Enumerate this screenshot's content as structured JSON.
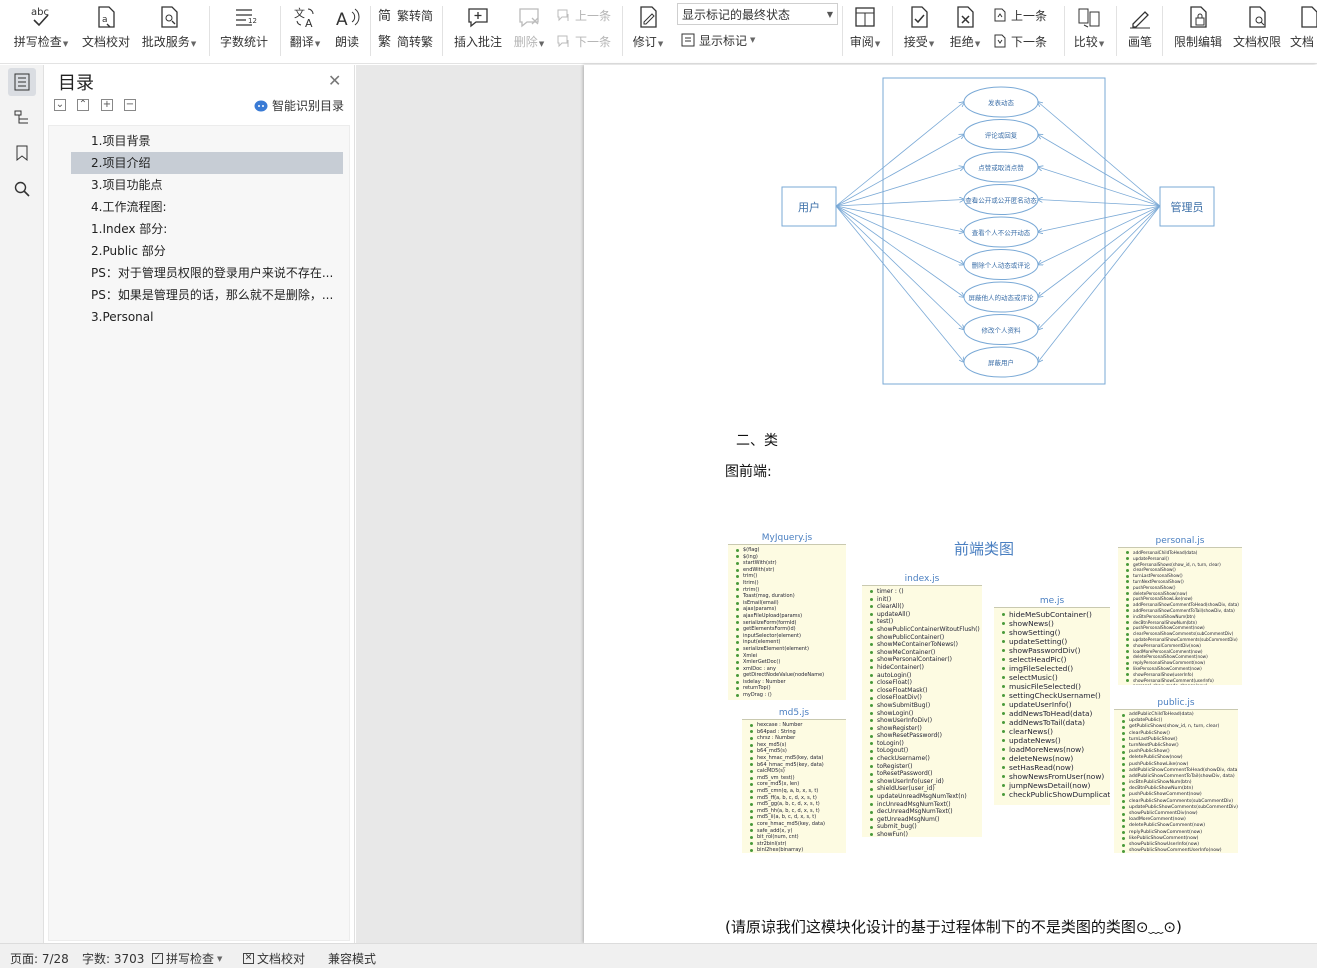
{
  "ribbon": {
    "spellcheck": "拼写检查",
    "doc_proof": "文档校对",
    "review_service": "批改服务",
    "word_count": "字数统计",
    "translate": "翻译",
    "read_aloud": "朗读",
    "trad_to_simp": "繁转简",
    "simp_to_trad": "简转繁",
    "insert_comment": "插入批注",
    "delete_comment": "删除",
    "prev_comment": "上一条",
    "next_comment": "下一条",
    "track_changes": "修订",
    "markup_state": "显示标记的最终状态",
    "show_markup": "显示标记",
    "review": "审阅",
    "accept": "接受",
    "reject": "拒绝",
    "prev_change": "上一条",
    "next_change": "下一条",
    "compare": "比较",
    "pen": "画笔",
    "restrict_edit": "限制编辑",
    "doc_permission": "文档权限",
    "doc_cut": "文档"
  },
  "toc": {
    "title": "目录",
    "smart_label": "智能识别目录",
    "items": [
      {
        "label": "1.项目背景",
        "selected": false
      },
      {
        "label": "2.项目介绍",
        "selected": true
      },
      {
        "label": "3.项目功能点",
        "selected": false
      },
      {
        "label": "4.工作流程图:",
        "selected": false
      },
      {
        "label": "1.Index 部分:",
        "selected": false
      },
      {
        "label": "2.Public 部分",
        "selected": false
      },
      {
        "label": "PS：对于管理员权限的登录用户来说不存在...",
        "selected": false
      },
      {
        "label": "PS：如果是管理员的话，那么就不是删除，...",
        "selected": false
      },
      {
        "label": "3.Personal",
        "selected": false
      }
    ]
  },
  "document": {
    "usecase": {
      "actor_user": "用户",
      "actor_admin": "管理员",
      "cases": [
        "发表动态",
        "评论或回复",
        "点赞或取消点赞",
        "查看公开或公开匿名动态",
        "查看个人不公开动态",
        "删除个人动态或评论",
        "屏蔽他人的动态或评论",
        "修改个人资料",
        "屏蔽用户"
      ]
    },
    "section_heading": "二、类",
    "section_sub": "图前端:",
    "class_diagram": {
      "title": "前端类图",
      "classes": [
        {
          "name": "MyJquery.js",
          "members": [
            "$(flag)",
            "$(ing)",
            "startWith(str)",
            "endWith(str)",
            "trim()",
            "ltrim()",
            "rtrim()",
            "Toast(msg, duration)",
            "isEmail(email)",
            "ajax(params)",
            "ajaxFileUpload(params)",
            "serializeForm(formId)",
            "getElementsForm(id)",
            "inputSelector(element)",
            "input(element)",
            "serializeElement(element)",
            "Xmlei",
            "XmlerGetDoc()",
            "xmlDoc : any",
            "getDirectNodeValue(nodeName)",
            "isdelay : Number",
            "returnTop()",
            "myDrag : ()"
          ]
        },
        {
          "name": "md5.js",
          "members": [
            "hexcase : Number",
            "b64pad : String",
            "chrsz : Number",
            "hex_md5(s)",
            "b64_md5(s)",
            "hex_hmac_md5(key, data)",
            "b64_hmac_md5(key, data)",
            "calcMD5(s)",
            "md5_vm_test()",
            "core_md5(x, len)",
            "md5_cmn(q, a, b, x, s, t)",
            "md5_ff(a, b, c, d, x, s, t)",
            "md5_gg(a, b, c, d, x, s, t)",
            "md5_hh(a, b, c, d, x, s, t)",
            "md5_ii(a, b, c, d, x, s, t)",
            "core_hmac_md5(key, data)",
            "safe_add(x, y)",
            "bit_rol(num, cnt)",
            "str2binl(str)",
            "binl2hex(binarray)",
            "binl2b64(binarray)"
          ]
        },
        {
          "name": "index.js",
          "members": [
            "timer : ()",
            "init()",
            "clearAll()",
            "updateAll()",
            "test()",
            "showPublicContainerWitoutFlush()",
            "showPublicContainer()",
            "showMeContainerToNews()",
            "showMeContainer()",
            "showPersonalContainer()",
            "hideContainer()",
            "autoLogin()",
            "closeFloat()",
            "closeFloatMask()",
            "closeFloatDiv()",
            "showSubmitBug()",
            "showLogin()",
            "showUserInfoDiv()",
            "showRegister()",
            "showResetPassword()",
            "toLogin()",
            "toLogout()",
            "checkUsername()",
            "toRegister()",
            "toResetPassword()",
            "showUserInfo(user_id)",
            "shieldUser(user_id)",
            "updateUnreadMsgNumText(n)",
            "incUnreadMsgNumText()",
            "decUnreadMsgNumText()",
            "getUnreadMsgNum()",
            "submit_bug()",
            "showFun()"
          ]
        },
        {
          "name": "me.js",
          "members": [
            "hideMeSubContainer()",
            "showNews()",
            "showSetting()",
            "updateSetting()",
            "showPasswordDiv()",
            "selectHeadPic()",
            "imgFileSelected()",
            "selectMusic()",
            "musicFileSelected()",
            "settingCheckUsername()",
            "updateUserInfo()",
            "addNewsToHead(data)",
            "addNewsToTail(data)",
            "clearNews()",
            "updateNews()",
            "loadMoreNews(now)",
            "deleteNews(now)",
            "setHasRead(now)",
            "showNewsFromUser(now)",
            "jumpNewsDetail(now)",
            "checkPublicShowDumplicate()"
          ]
        },
        {
          "name": "personal.js",
          "members": [
            "addPersonalChildToHead(data)",
            "updatePersonal()",
            "getPersonalShows(show_id, n, turn, clear)",
            "clearPersonalShow()",
            "turnLastPersonalShow()",
            "turnNextPersonalShow()",
            "pushPersonalShow()",
            "deletePersonalShow(now)",
            "pushPersonalShowLike(now)",
            "addPersonalShowCommentToHead(showDiv, data)",
            "addPersonalShowCommentToTail(showDiv, data)",
            "incBtnPersonalShowNum(btn)",
            "decBtnPersonalShowNum(btn)",
            "pushPersonalShowComment(now)",
            "clearPersonalShowComments(subCommentDiv)",
            "updatePersonalShowComments(subCommentDiv)",
            "showPersonalCommentDiv(now)",
            "loadMorePersonalComment(now)",
            "deletePersonalShowComment(now)",
            "replyPersonalShowComment(now)",
            "likePersonalShowComment(now)",
            "showPersonalShow(userInfo)",
            "showPersonalShowComment(userInfo)",
            "personal_show_mode_change(now)"
          ]
        },
        {
          "name": "public.js",
          "members": [
            "addPublicChildToHead(data)",
            "updatePublic()",
            "getPublicShows(show_id, n, turn, clear)",
            "clearPublicShow()",
            "turnLastPublicShow()",
            "turnNextPublicShow()",
            "pushPublicShow()",
            "deletePublicShow(now)",
            "pushPublicShowLike(now)",
            "addPublicShowCommentToHead(showDiv, data)",
            "addPublicShowCommentToTail(showDiv, data)",
            "incBtnPublicShowNum(btn)",
            "decBtnPublicShowNum(btn)",
            "pushPublicShowComment(now)",
            "clearPublicShowComments(subCommentDiv)",
            "updatePublicShowComments(subCommentDiv)",
            "showPublicCommentDiv(now)",
            "loadMoreComment(now)",
            "deletePublicShowComment(now)",
            "replyPublicShowComment(now)",
            "likePublicShowComment(now)",
            "showPublicShowUserInfo(now)",
            "showPublicShowCommentUserInfo(now)"
          ]
        }
      ]
    },
    "footnote": "(请原谅我们这模块化设计的基于过程体制下的不是类图的类图⊙﹏⊙)"
  },
  "status": {
    "page": "页面: 7/28",
    "words": "字数: 3703",
    "spell": "拼写检查",
    "proof": "文档校对",
    "compat": "兼容模式"
  }
}
